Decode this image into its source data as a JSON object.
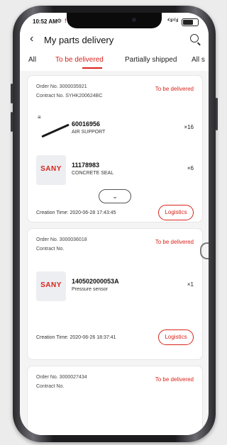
{
  "status_bar": {
    "time": "10:52 AM",
    "gear_icon": "gear-icon",
    "signal": "⁴ᴳ.ıl ⁴ᴳ.ıl"
  },
  "header": {
    "back_icon": "back-chevron-icon",
    "title": "My parts delivery",
    "search_icon": "search-icon"
  },
  "tabs": [
    {
      "label": "All",
      "active": false
    },
    {
      "label": "To be delivered",
      "active": true
    },
    {
      "label": "Partially shipped",
      "active": false
    },
    {
      "label": "All s",
      "active": false
    }
  ],
  "orders": [
    {
      "order_no": "Order No. 3000035921",
      "contract_no": "Contract No. SYHK200624BC",
      "status": "To be delivered",
      "items": [
        {
          "image": "air-support-image",
          "code": "60016956",
          "name": "AIR SUPPORT",
          "qty": "×16"
        },
        {
          "image": "sany-logo",
          "logo_text": "SANY",
          "code": "11178983",
          "name": "CONCRETE SEAL",
          "qty": "×6"
        }
      ],
      "expand_icon": "chevron-down-icon",
      "creation_time": "Creation Time: 2020-06-28 17:43:45",
      "logistics_label": "Logistics"
    },
    {
      "order_no": "Order No. 3000036018",
      "contract_no": "Contract No.",
      "status": "To be delivered",
      "items": [
        {
          "image": "sany-logo",
          "logo_text": "SANY",
          "code": "140502000053A",
          "name": "Pressure sensor",
          "qty": "×1"
        }
      ],
      "creation_time": "Creation Time: 2020-06-26 18:37:41",
      "logistics_label": "Logistics"
    },
    {
      "order_no": "Order No. 3000027434",
      "contract_no": "Contract No.",
      "status": "To be delivered"
    }
  ],
  "colors": {
    "accent": "#d8231a",
    "background": "#f4f4f4",
    "card": "#ffffff"
  }
}
